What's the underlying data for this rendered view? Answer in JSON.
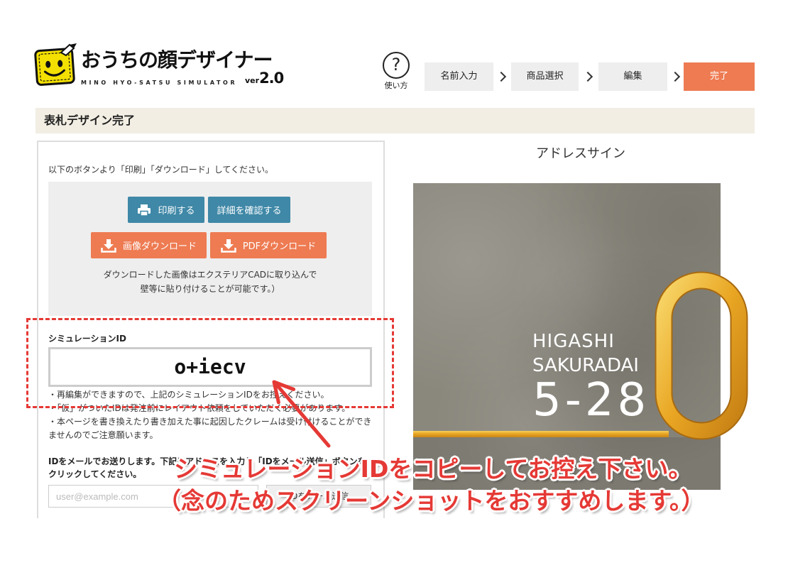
{
  "header": {
    "logo": {
      "title": "おうちの顔デザイナー",
      "subtitle": "MINO HYO-SATSU SIMULATOR",
      "version_prefix": "ver",
      "version": "2.0"
    },
    "help": {
      "symbol": "?",
      "label": "使い方"
    },
    "steps": [
      {
        "label": "名前入力",
        "active": false
      },
      {
        "label": "商品選択",
        "active": false
      },
      {
        "label": "編集",
        "active": false
      },
      {
        "label": "完了",
        "active": true
      }
    ]
  },
  "section_title": "表札デザイン完了",
  "left_panel": {
    "instruction": "以下のボタンより「印刷」「ダウンロード」してください。",
    "buttons": {
      "print": {
        "label": "印刷する",
        "icon": "printer-icon"
      },
      "details": {
        "label": "詳細を確認する"
      },
      "image_download": {
        "label": "画像ダウンロード",
        "icon": "download-icon"
      },
      "pdf_download": {
        "label": "PDFダウンロード",
        "icon": "download-icon"
      }
    },
    "download_note": [
      "ダウンロードした画像はエクステリアCADに取り込んで",
      "壁等に貼り付けることが可能です。）"
    ],
    "simulation_id": {
      "label": "シミュレーションID",
      "value": "o+iecv"
    },
    "notes": [
      "・再編集ができますので、上記のシミュレーションIDをお控えください。",
      "・「仮」がついたIDは発注前にレイアウト依頼をしていただく必要があります。",
      "・本ページを書き換えたり書き加えた事に起因したクレームは受け付けることができませんのでご注意願います。"
    ],
    "email": {
      "instruction": "IDをメールでお送りします。下記にアドレスを入力し「IDをメール送信」ボタンをクリックしてください。",
      "placeholder": "user@example.com",
      "value": "",
      "button": "IDをメール送信"
    }
  },
  "right_panel": {
    "title": "アドレスサイン",
    "sign": {
      "line1": "HIGASHI",
      "line2": "SAKURADAI",
      "number": "5-28"
    }
  },
  "annotation": {
    "line1": "シミュレーションIDをコピーしてお控え下さい。",
    "line2": "（念のためスクリーンショットをおすすめします。）"
  },
  "colors": {
    "accent_orange": "#ee7b52",
    "button_blue": "#3f88a7",
    "section_bg": "#f2eee3",
    "annotation_red": "#e53935",
    "sign_gold": "#e9a623",
    "sign_concrete": "#8a877d"
  }
}
